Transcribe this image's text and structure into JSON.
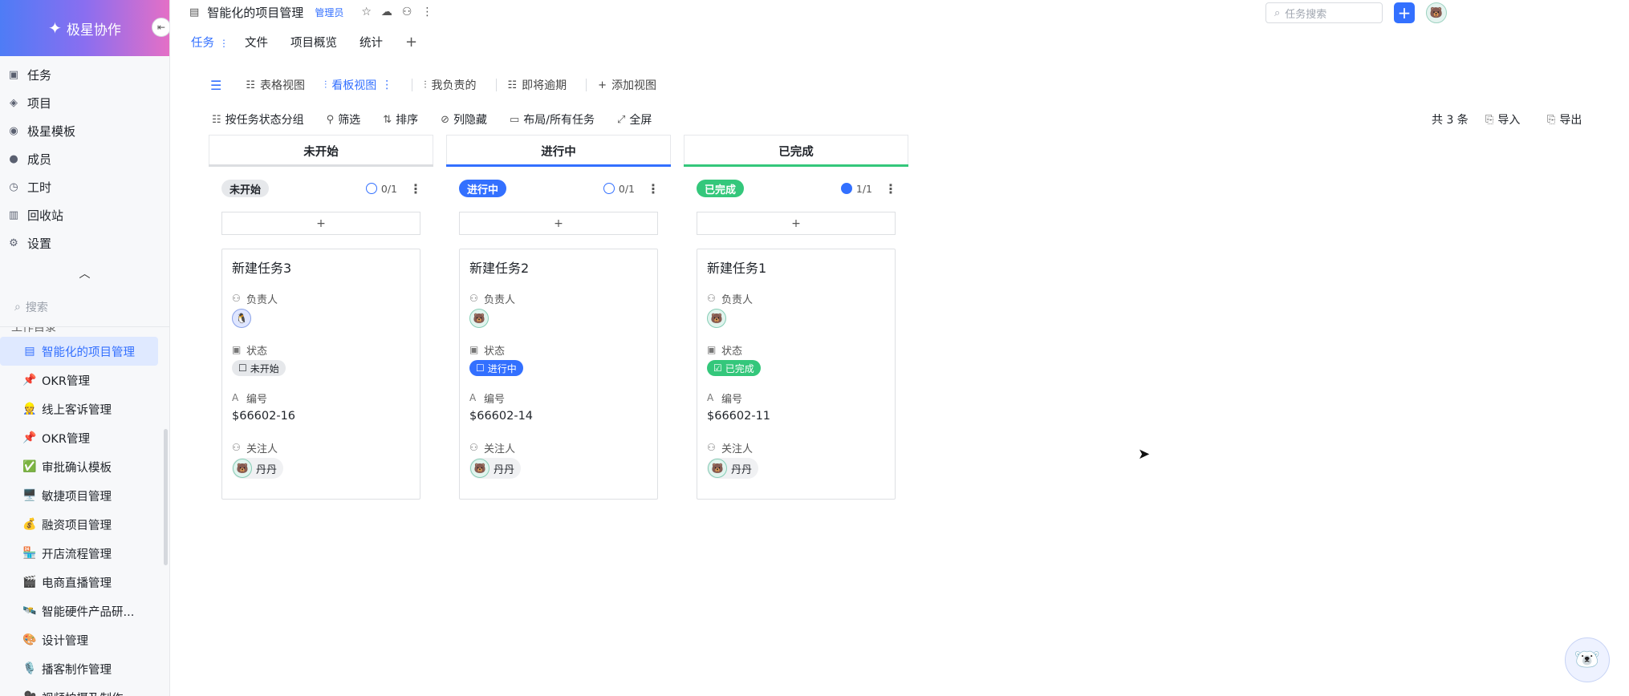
{
  "brand": {
    "name": "极星协作",
    "logo_icon": "star-logo-icon"
  },
  "sidebar": {
    "nav": [
      {
        "label": "任务",
        "icon": "task-icon"
      },
      {
        "label": "项目",
        "icon": "project-icon"
      },
      {
        "label": "极星模板",
        "icon": "template-icon"
      },
      {
        "label": "成员",
        "icon": "member-icon"
      },
      {
        "label": "工时",
        "icon": "clock-icon"
      },
      {
        "label": "回收站",
        "icon": "trash-icon"
      },
      {
        "label": "设置",
        "icon": "gear-icon"
      }
    ],
    "search_placeholder": "搜索",
    "tree_partial": "工作目录",
    "tree": [
      {
        "emoji": "▤",
        "label": "智能化的项目管理",
        "active": true
      },
      {
        "emoji": "📌",
        "label": "OKR管理"
      },
      {
        "emoji": "👷",
        "label": "线上客诉管理"
      },
      {
        "emoji": "📌",
        "label": "OKR管理"
      },
      {
        "emoji": "✅",
        "label": "审批确认模板"
      },
      {
        "emoji": "🖥️",
        "label": "敏捷项目管理"
      },
      {
        "emoji": "💰",
        "label": "融资项目管理"
      },
      {
        "emoji": "🏪",
        "label": "开店流程管理"
      },
      {
        "emoji": "🎬",
        "label": "电商直播管理"
      },
      {
        "emoji": "🛰️",
        "label": "智能硬件产品研..."
      },
      {
        "emoji": "🎨",
        "label": "设计管理"
      },
      {
        "emoji": "🎙️",
        "label": "播客制作管理"
      },
      {
        "emoji": "🎥",
        "label": "视频拍摄及制作"
      }
    ]
  },
  "header": {
    "title": "智能化的项目管理",
    "role": "管理员",
    "search_placeholder": "任务搜索",
    "add_label": "+"
  },
  "tabs": [
    {
      "label": "任务"
    },
    {
      "label": "文件"
    },
    {
      "label": "项目概览"
    },
    {
      "label": "统计"
    }
  ],
  "tab_add": "+",
  "views": [
    {
      "label": "表格视图",
      "icon": "table-view-icon"
    },
    {
      "label": "看板视图",
      "icon": "kanban-view-icon",
      "active": true
    },
    {
      "label": "我负责的",
      "icon": "kanban-view-icon"
    },
    {
      "label": "即将逾期",
      "icon": "table-view-icon"
    },
    {
      "label": "添加视图",
      "icon": "plus-icon"
    }
  ],
  "toolbar": {
    "group": "按任务状态分组",
    "filter": "筛选",
    "sort": "排序",
    "hide_cols": "列隐藏",
    "layout": "布局/所有任务",
    "fullscreen": "全屏",
    "total": "共 3 条",
    "import": "导入",
    "export": "导出"
  },
  "columns": [
    {
      "header": "未开始",
      "chip": "未开始",
      "count": "0/1",
      "accent": "#dcdee1",
      "chip_bg": "#e6e8eb",
      "chip_color": "#1f2329",
      "add": "+",
      "card": {
        "title": "新建任务3",
        "owner_label": "负责人",
        "state_label": "状态",
        "state": "未开始",
        "state_bg": "#e6e8eb",
        "state_color": "#1f2329",
        "code_label": "编号",
        "code": "$66602-16",
        "watcher_label": "关注人",
        "watcher": "丹丹"
      }
    },
    {
      "header": "进行中",
      "chip": "进行中",
      "count": "0/1",
      "accent": "#3370ff",
      "chip_bg": "#3370ff",
      "chip_color": "#ffffff",
      "add": "+",
      "card": {
        "title": "新建任务2",
        "owner_label": "负责人",
        "state_label": "状态",
        "state": "进行中",
        "state_bg": "#3370ff",
        "state_color": "#ffffff",
        "code_label": "编号",
        "code": "$66602-14",
        "watcher_label": "关注人",
        "watcher": "丹丹"
      }
    },
    {
      "header": "已完成",
      "chip": "已完成",
      "count": "1/1",
      "accent": "#34c77b",
      "chip_bg": "#34c77b",
      "chip_color": "#ffffff",
      "add": "+",
      "card": {
        "title": "新建任务1",
        "owner_label": "负责人",
        "state_label": "状态",
        "state": "已完成",
        "state_bg": "#34c77b",
        "state_color": "#ffffff",
        "code_label": "编号",
        "code": "$66602-11",
        "watcher_label": "关注人",
        "watcher": "丹丹"
      }
    }
  ]
}
